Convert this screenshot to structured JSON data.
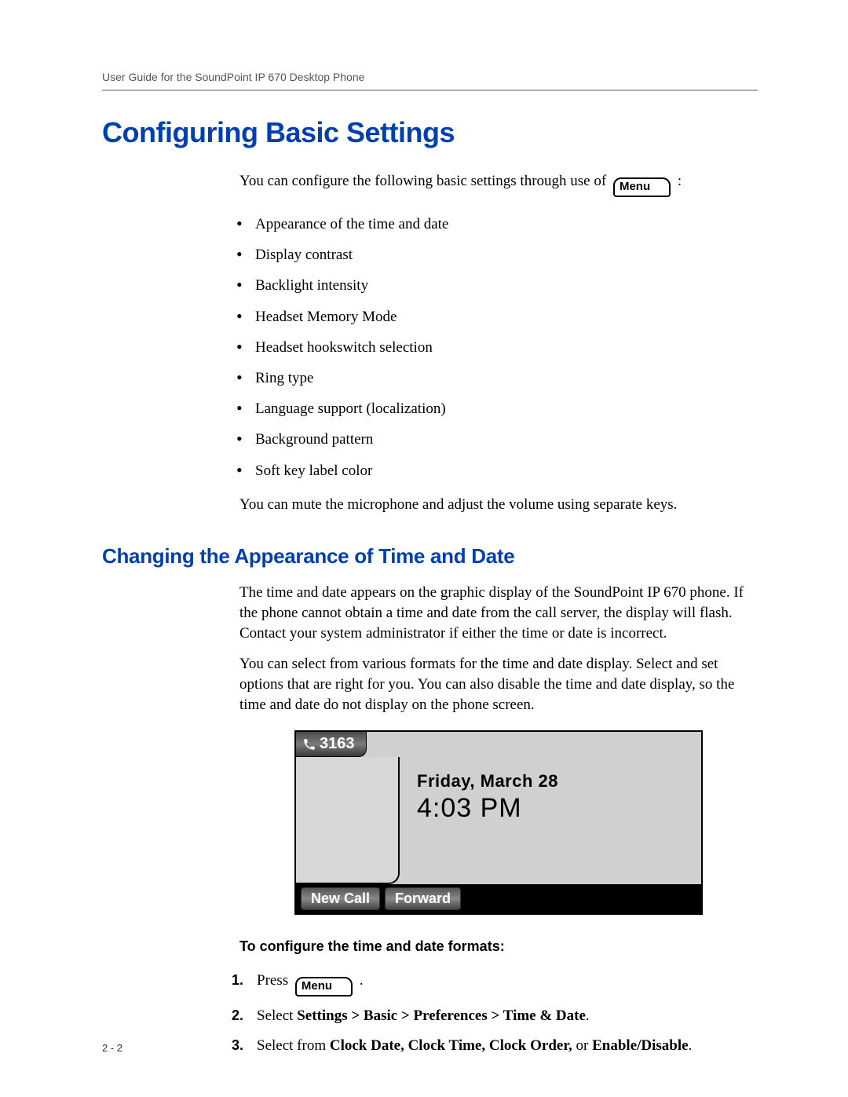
{
  "header": {
    "running": "User Guide for the SoundPoint IP 670 Desktop Phone"
  },
  "heading_main": "Configuring Basic Settings",
  "intro": {
    "lead": "You can configure the following basic settings through use of",
    "menu_key_label": "Menu",
    "tail": " :"
  },
  "settings_list": [
    "Appearance of the time and date",
    "Display contrast",
    "Backlight intensity",
    "Headset Memory Mode",
    "Headset hookswitch selection",
    "Ring type",
    "Language support (localization)",
    "Background pattern",
    "Soft key label color"
  ],
  "mute_note": "You can mute the microphone and adjust the volume using separate keys.",
  "heading_sub": "Changing the Appearance of Time and Date",
  "time_date": {
    "p1": "The time and date appears on the graphic display of the SoundPoint IP 670 phone. If the phone cannot obtain a time and date from the call server, the display will flash. Contact your system administrator if either the time or date is incorrect.",
    "p2": "You can select from various formats for the time and date display. Select and set options that are right for you. You can also disable the time and date display, so the time and date do not display on the phone screen."
  },
  "phone": {
    "extension": "3163",
    "date": "Friday, March 28",
    "time": "4:03 PM",
    "softkeys": [
      "New Call",
      "Forward"
    ]
  },
  "procedure": {
    "heading": "To configure the time and date formats:",
    "steps": {
      "s1_pre": "Press",
      "s1_key": "Menu",
      "s1_post": " .",
      "s2_pre": "Select ",
      "s2_bold": "Settings > Basic > Preferences > Time & Date",
      "s2_post": ".",
      "s3_pre": "Select from ",
      "s3_bold": "Clock Date, Clock Time, Clock Order, ",
      "s3_mid": "or ",
      "s3_bold2": "Enable/Disable",
      "s3_post": "."
    }
  },
  "page_number": "2 - 2"
}
